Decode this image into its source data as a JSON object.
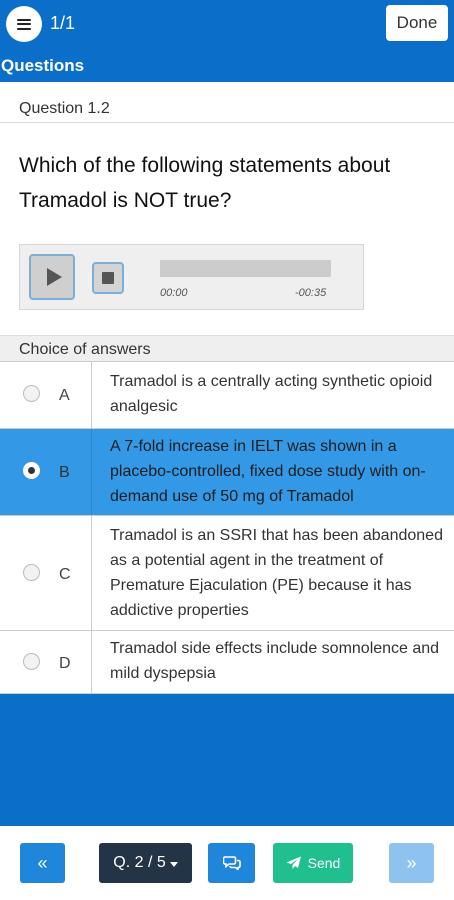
{
  "header": {
    "counter": "1/1",
    "done_label": "Done",
    "section_title": "Questions"
  },
  "question": {
    "number": "Question 1.2",
    "text": "Which of the following statements about Tramadol is NOT true?"
  },
  "player": {
    "current_time": "00:00",
    "remaining_time": "-00:35"
  },
  "choices": {
    "header": "Choice of answers",
    "selected": "B",
    "items": [
      {
        "letter": "A",
        "text": "Tramadol is a centrally acting synthetic opioid analgesic"
      },
      {
        "letter": "B",
        "text": "A 7-fold increase in IELT was shown in a placebo-controlled, fixed dose study with on-demand use of 50 mg of Tramadol"
      },
      {
        "letter": "C",
        "text": "Tramadol is an SSRI that has been abandoned as a potential agent in the treatment of Premature Ejaculation (PE) because it has addictive properties"
      },
      {
        "letter": "D",
        "text": "Tramadol side effects include somnolence and mild dyspepsia"
      }
    ]
  },
  "footer": {
    "prev_label": "«",
    "question_selector": "Q. 2 / 5",
    "send_label": "Send",
    "next_label": "»"
  },
  "icons": {
    "menu": "hamburger-icon",
    "play": "play-icon",
    "stop": "stop-icon",
    "comment": "comments-icon",
    "send": "paper-plane-icon",
    "caret": "caret-down-icon"
  },
  "colors": {
    "primary": "#0b6fc9",
    "selected_answer": "#3399e6",
    "send": "#1fbf8f",
    "dark_button": "#243447"
  }
}
